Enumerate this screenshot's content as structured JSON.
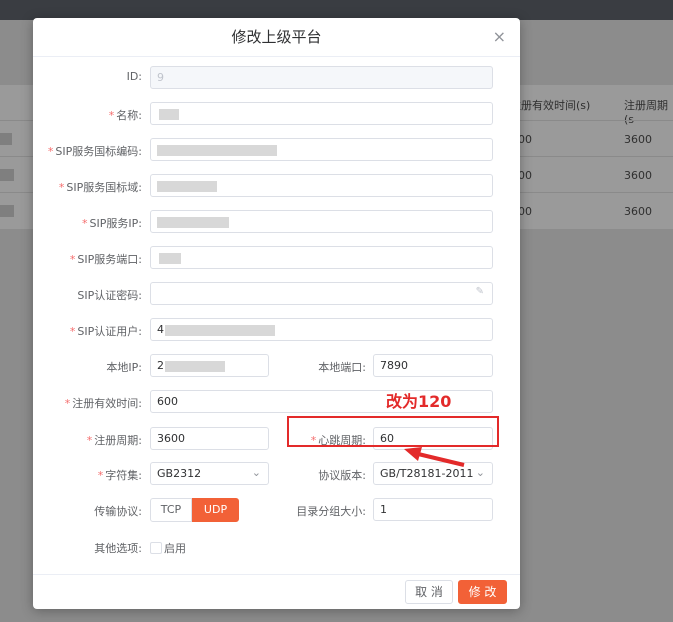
{
  "background": {
    "table_headers": [
      "注册有效时间(s)",
      "注册周期(s"
    ],
    "rows": [
      {
        "expire": "00",
        "period": "3600"
      },
      {
        "expire": "00",
        "period": "3600"
      },
      {
        "expire": "00",
        "period": "3600"
      }
    ]
  },
  "dialog": {
    "title": "修改上级平台",
    "close_glyph": "×",
    "fields": {
      "id": {
        "label": "ID:",
        "value": "9"
      },
      "name": {
        "label": "名称:",
        "value": ""
      },
      "sip_id": {
        "label": "SIP服务国标编码:",
        "value": ""
      },
      "sip_domain": {
        "label": "SIP服务国标域:",
        "value": ""
      },
      "sip_ip": {
        "label": "SIP服务IP:",
        "value": ""
      },
      "sip_port": {
        "label": "SIP服务端口:",
        "value": ""
      },
      "sip_password": {
        "label": "SIP认证密码:",
        "value": ""
      },
      "sip_user": {
        "label": "SIP认证用户:",
        "value": "4"
      },
      "local_ip": {
        "label": "本地IP:",
        "value": "2"
      },
      "local_port": {
        "label": "本地端口:",
        "value": "7890"
      },
      "expire": {
        "label": "注册有效时间:",
        "value": "600"
      },
      "register_period": {
        "label": "注册周期:",
        "value": "3600"
      },
      "keepalive": {
        "label": "心跳周期:",
        "value": "60"
      },
      "charset": {
        "label": "字符集:",
        "value": "GB2312"
      },
      "protocol_version": {
        "label": "协议版本:",
        "value": "GB/T28181-2011"
      },
      "transport": {
        "label": "传输协议:",
        "options": [
          "TCP",
          "UDP"
        ],
        "selected": "UDP"
      },
      "catalog_group_size": {
        "label": "目录分组大小:",
        "value": "1"
      },
      "other_options": {
        "label": "其他选项:",
        "checkbox_label": "启用"
      }
    },
    "buttons": {
      "cancel": "取 消",
      "submit": "修 改"
    }
  },
  "annotation": {
    "text": "改为120",
    "color": "#e32a2a"
  },
  "colors": {
    "accent": "#f26137",
    "required": "#f56c6c"
  }
}
